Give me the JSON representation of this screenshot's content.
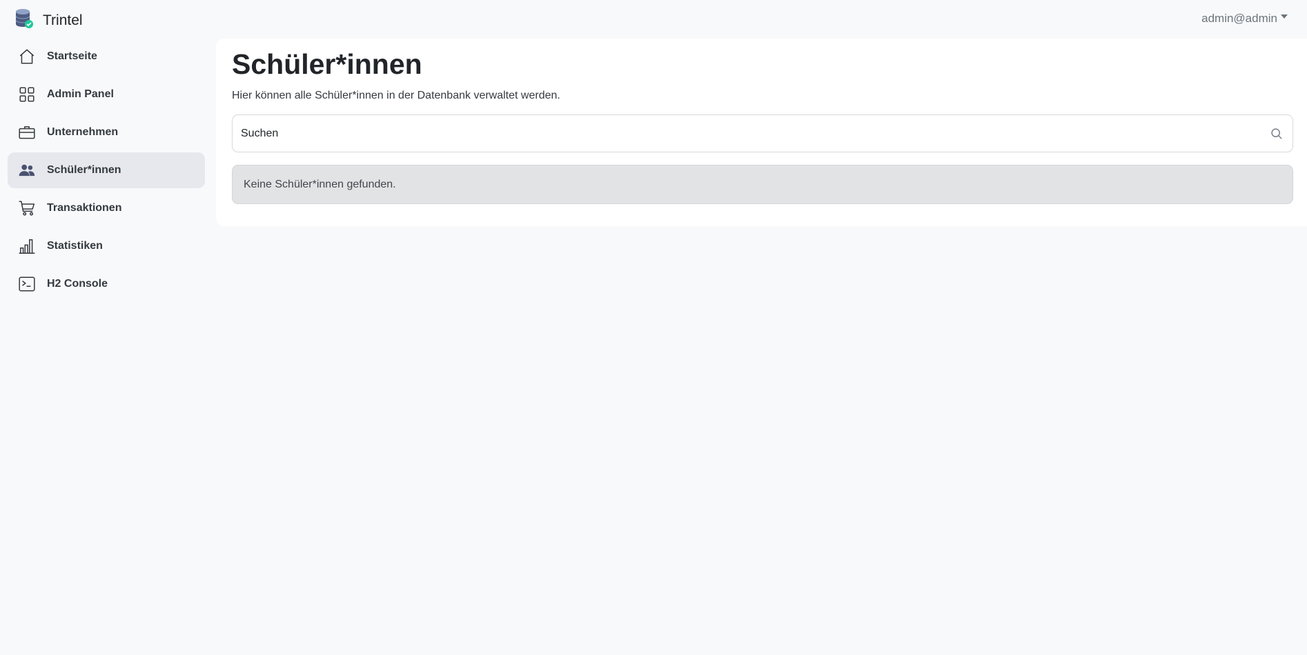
{
  "app": {
    "name": "Trintel",
    "logo_icon": "database-check-icon"
  },
  "user_menu": {
    "label": "admin@admin"
  },
  "sidebar": {
    "items": [
      {
        "label": "Startseite",
        "icon": "house-icon"
      },
      {
        "label": "Admin Panel",
        "icon": "grid-icon"
      },
      {
        "label": "Unternehmen",
        "icon": "briefcase-icon"
      },
      {
        "label": "Schüler*innen",
        "icon": "people-icon",
        "active": true
      },
      {
        "label": "Transaktionen",
        "icon": "cart-icon"
      },
      {
        "label": "Statistiken",
        "icon": "bar-chart-icon"
      },
      {
        "label": "H2 Console",
        "icon": "terminal-icon"
      }
    ]
  },
  "main": {
    "title": "Schüler*innen",
    "description": "Hier können alle Schüler*innen in der Datenbank verwaltet werden.",
    "search": {
      "placeholder": "Suchen",
      "value": ""
    },
    "empty_message": "Keine Schüler*innen gefunden."
  },
  "colors": {
    "active_item_bg": "#e7e8ed",
    "alert_bg": "#e2e3e5",
    "page_bg": "#f8f9fa",
    "logo_badge": "#20c997"
  }
}
